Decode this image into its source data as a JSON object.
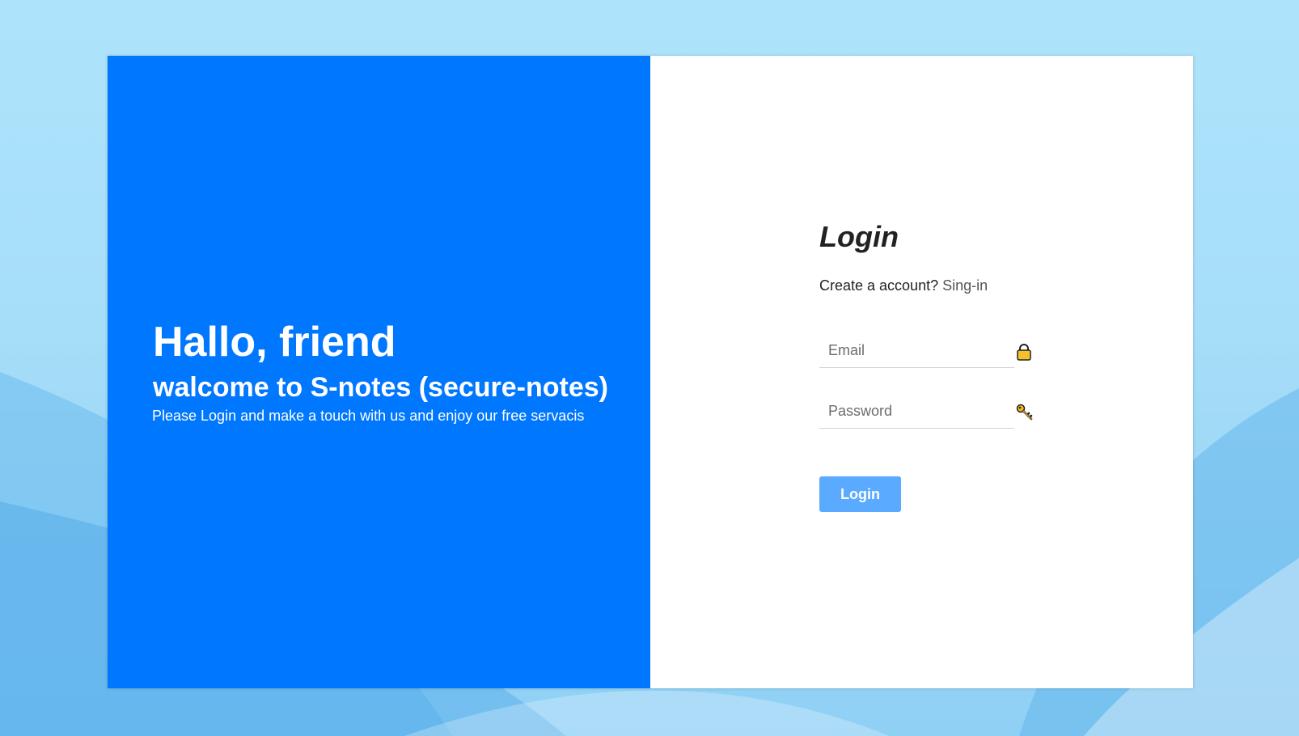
{
  "welcome": {
    "title": "Hallo, friend",
    "subtitle": "walcome to S-notes (secure-notes)",
    "text": "Please Login and make a touch with us and enjoy our free servacis"
  },
  "login": {
    "title": "Login",
    "account_prompt": "Create a account?",
    "signin_link": "Sing-in",
    "email_placeholder": "Email",
    "password_placeholder": "Password",
    "submit_label": "Login"
  },
  "icons": {
    "email": "lock-icon",
    "password": "key-icon"
  },
  "colors": {
    "brand": "#0077ff",
    "button": "#5aaaff",
    "background": "#a6ddf8"
  }
}
